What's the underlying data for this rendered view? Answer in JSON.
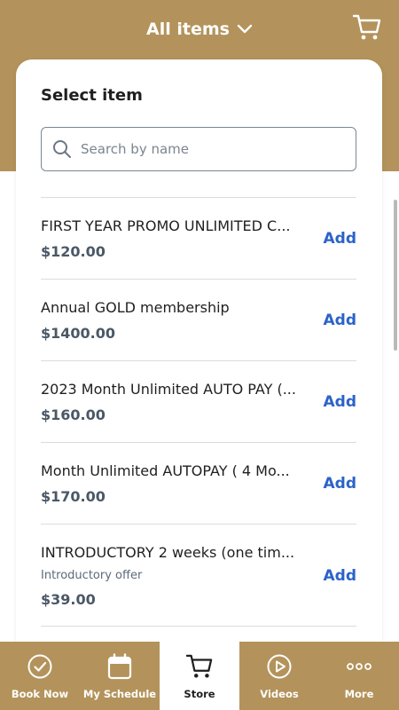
{
  "header": {
    "title": "All items",
    "cart_icon": "cart-icon",
    "background": "#b3935b"
  },
  "panel": {
    "title": "Select item",
    "search_placeholder": "Search by name"
  },
  "items": [
    {
      "name": "FIRST YEAR PROMO UNLIMITED C...",
      "price": "$120.00",
      "action": "Add"
    },
    {
      "name": "Annual GOLD membership",
      "price": "$1400.00",
      "action": "Add"
    },
    {
      "name": "2023 Month Unlimited AUTO PAY (...",
      "price": "$160.00",
      "action": "Add"
    },
    {
      "name": "Month Unlimited AUTOPAY ( 4 Mo...",
      "price": "$170.00",
      "action": "Add"
    },
    {
      "name": "INTRODUCTORY 2 weeks (one tim...",
      "subtitle": "Introductory offer",
      "price": "$39.00",
      "action": "Add"
    }
  ],
  "tabs": [
    {
      "label": "Book Now",
      "icon": "check-circle-icon"
    },
    {
      "label": "My Schedule",
      "icon": "calendar-icon"
    },
    {
      "label": "Store",
      "icon": "cart-icon",
      "active": true
    },
    {
      "label": "Videos",
      "icon": "play-circle-icon"
    },
    {
      "label": "More",
      "icon": "more-dots-icon"
    }
  ],
  "colors": {
    "brand": "#b3935b",
    "link": "#2b63c8"
  }
}
